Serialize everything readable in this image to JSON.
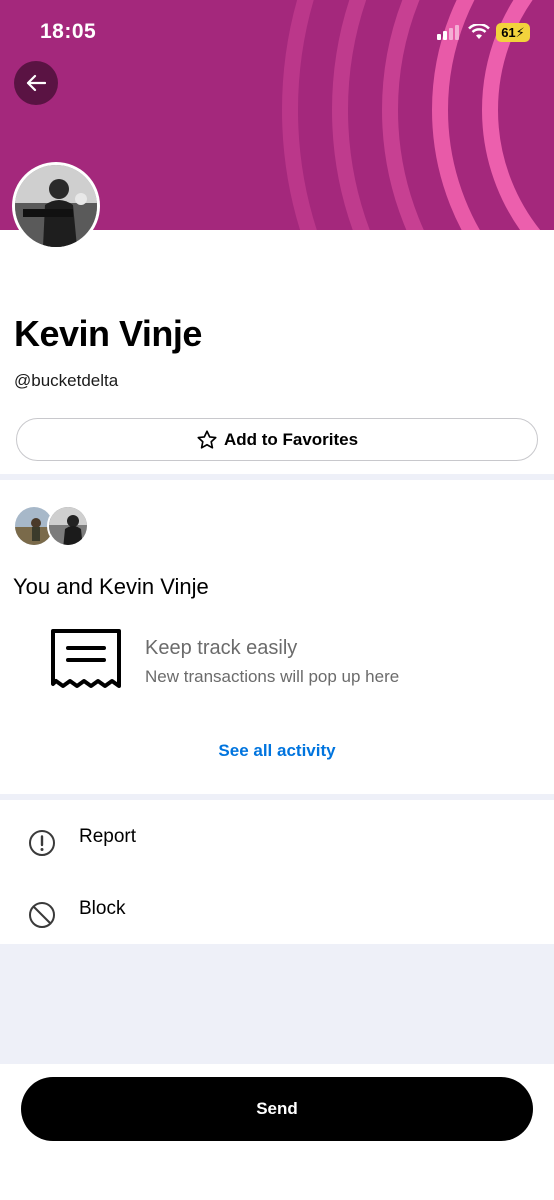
{
  "status_bar": {
    "time": "18:05",
    "battery": "61"
  },
  "profile": {
    "name": "Kevin Vinje",
    "handle": "@bucketdelta",
    "favorite_label": "Add to Favorites"
  },
  "activity": {
    "title": "You and Kevin Vinje",
    "empty_title": "Keep track easily",
    "empty_subtitle": "New transactions will pop up here",
    "see_all_label": "See all activity"
  },
  "actions": [
    {
      "label": "Report",
      "icon": "alert-circle-icon"
    },
    {
      "label": "Block",
      "icon": "block-icon"
    }
  ],
  "footer": {
    "send_label": "Send"
  },
  "colors": {
    "banner": "#a4287c",
    "ring": "#e0529f",
    "link": "#0074de"
  }
}
